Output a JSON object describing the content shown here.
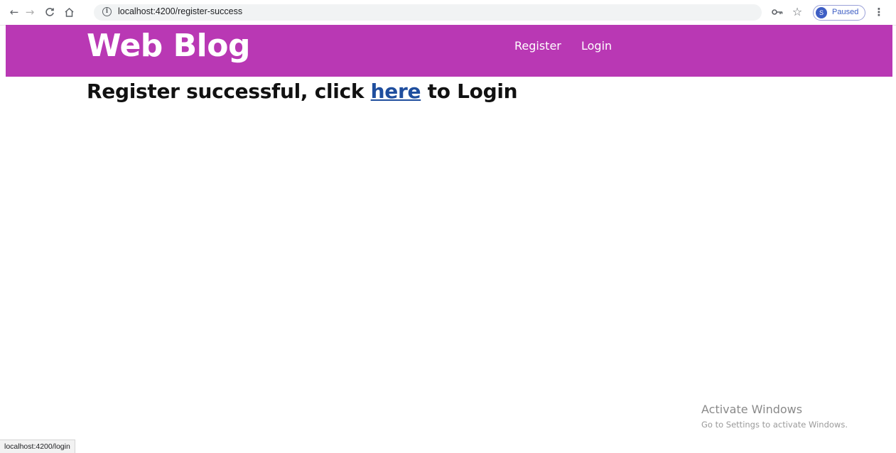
{
  "browser": {
    "back_icon": "arrow-left",
    "forward_icon": "arrow-right",
    "reload_icon": "reload",
    "home_icon": "home",
    "url": "localhost:4200/register-success",
    "profile_initial": "S",
    "profile_status": "Paused",
    "status_url": "localhost:4200/login"
  },
  "header": {
    "brand": "Web Blog",
    "nav": [
      {
        "label": "Register"
      },
      {
        "label": "Login"
      }
    ],
    "color": "#b938b4"
  },
  "main": {
    "message_prefix": "Register successful, click ",
    "link_text": "here",
    "message_suffix": " to Login",
    "link_color": "#1f4e9e"
  },
  "watermark": {
    "title": "Activate Windows",
    "subtitle": "Go to Settings to activate Windows."
  }
}
